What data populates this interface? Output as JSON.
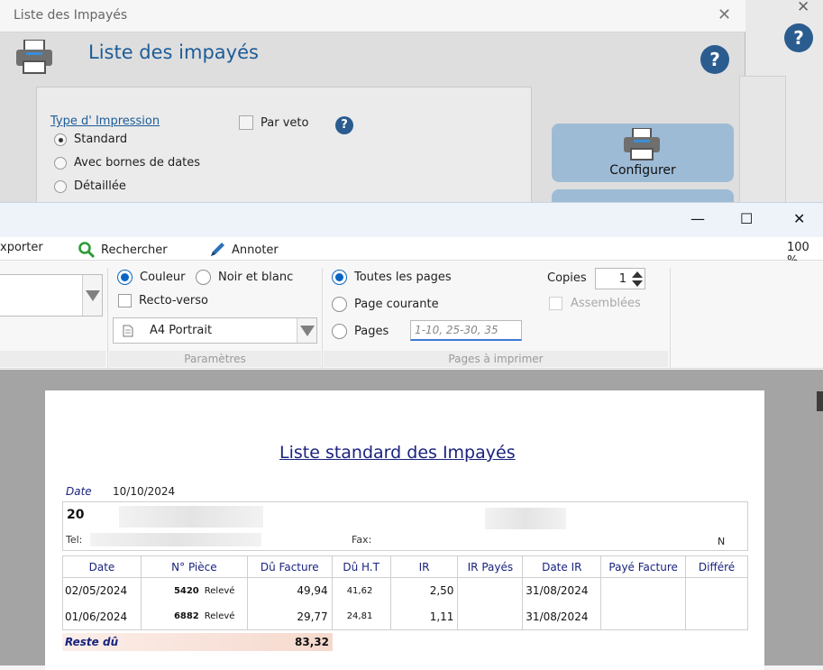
{
  "dialog": {
    "title": "Liste des Impayés",
    "heading": "Liste des impayés",
    "help_glyph": "?",
    "type_label": "Type d' Impression",
    "options": [
      "Standard",
      "Avec bornes de dates",
      "Détaillée"
    ],
    "selected_option": "Standard",
    "par_veto_label": "Par veto",
    "configure_label": "Configurer",
    "close_glyph": "✕"
  },
  "preview": {
    "window_controls": {
      "minimize": "—",
      "maximize": "☐",
      "close": "✕"
    },
    "toolbar": {
      "export_label": "xporter",
      "search_label": "Rechercher",
      "annotate_label": "Annoter",
      "zoom": "100 %"
    },
    "params": {
      "couleur": "Couleur",
      "noir_blanc": "Noir et blanc",
      "recto_verso": "Recto-verso",
      "format": "A4 Portrait",
      "caption": "Paramètres"
    },
    "pages": {
      "all": "Toutes les pages",
      "current": "Page courante",
      "range": "Pages",
      "range_placeholder": "1-10, 25-30, 35",
      "caption": "Pages à imprimer"
    },
    "copies": {
      "label": "Copies",
      "value": "1",
      "assembled": "Assemblées"
    }
  },
  "report": {
    "title": "Liste standard des Impayés",
    "date_label": "Date",
    "date_value": "10/10/2024",
    "client_number": "20",
    "tel_label": "Tel:",
    "fax_label": "Fax:",
    "n_label": "N",
    "columns": [
      "Date",
      "N° Pièce",
      "Dû Facture",
      "Dû H.T",
      "IR",
      "IR Payés",
      "Date IR",
      "Payé Facture",
      "Différé"
    ],
    "rows": [
      {
        "date": "02/05/2024",
        "piece_no": "5420",
        "piece_type": "Relevé",
        "du_facture": "49,94",
        "du_ht": "41,62",
        "ir": "2,50",
        "ir_payes": "",
        "date_ir": "31/08/2024",
        "paye_facture": "",
        "differe": ""
      },
      {
        "date": "01/06/2024",
        "piece_no": "6882",
        "piece_type": "Relevé",
        "du_facture": "29,77",
        "du_ht": "24,81",
        "ir": "1,11",
        "ir_payes": "",
        "date_ir": "31/08/2024",
        "paye_facture": "",
        "differe": ""
      }
    ],
    "reste_label": "Reste dû",
    "reste_value": "83,32"
  }
}
